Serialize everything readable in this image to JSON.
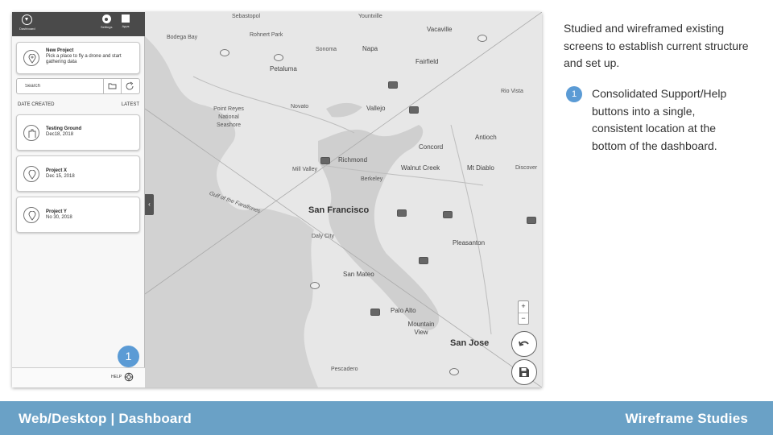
{
  "sidebar": {
    "topbar": {
      "dashboard_label": "Dashboard",
      "settings_label": "Settings",
      "apps_label": "Apps"
    },
    "new_project": {
      "title": "New Project",
      "subtitle": "Pick a place to fly a drone and start gathering data"
    },
    "search": {
      "placeholder": "Search"
    },
    "sort": {
      "left_label": "DATE CREATED",
      "right_label": "LATEST"
    },
    "projects": [
      {
        "name": "Testing Ground",
        "date": "Dec18, 2018",
        "icon": "boundary-icon"
      },
      {
        "name": "Project X",
        "date": "Dec 15, 2018",
        "icon": "map-pin-icon"
      },
      {
        "name": "Project Y",
        "date": "No 30, 2018",
        "icon": "map-pin-icon"
      }
    ],
    "footer": {
      "help_label": "HELP"
    },
    "badge": "1"
  },
  "map": {
    "places": {
      "sebastopol": "Sebastopol",
      "yountville": "Yountville",
      "bodega_bay": "Bodega Bay",
      "rohnert_park": "Rohnert Park",
      "vacaville": "Vacaville",
      "sonoma": "Sonoma",
      "napa": "Napa",
      "petaluma": "Petaluma",
      "fairfield": "Fairfield",
      "rio_vista": "Rio Vista",
      "novato": "Novato",
      "vallejo": "Vallejo",
      "point_reyes": "Point Reyes National Seashore",
      "concord": "Concord",
      "antioch": "Antioch",
      "richmond": "Richmond",
      "mill_valley": "Mill Valley",
      "walnut_creek": "Walnut Creek",
      "mt_diablo": "Mt Diablo",
      "discovery": "Discover",
      "berkeley": "Berkeley",
      "gulf": "Gulf of the Farallones",
      "san_francisco": "San Francisco",
      "daly_city": "Daly City",
      "pleasanton": "Pleasanton",
      "san_mateo": "San Mateo",
      "palo_alto": "Palo Alto",
      "mountain_view": "Mountain View",
      "san_jose": "San Jose",
      "pescadero": "Pescadero"
    },
    "zoom_in": "+",
    "zoom_out": "−"
  },
  "description": {
    "intro": "Studied and wireframed existing screens to establish current structure and set up.",
    "point_number": "1",
    "point_text": "Consolidated Support/Help buttons into a single, consistent location at the bottom of the dashboard."
  },
  "footer_bar": {
    "left": "Web/Desktop | Dashboard",
    "right": "Wireframe Studies",
    "color": "#6aa1c6"
  },
  "colors": {
    "accent": "#5b9bd5",
    "sidebar_top": "#4a4a4a"
  }
}
